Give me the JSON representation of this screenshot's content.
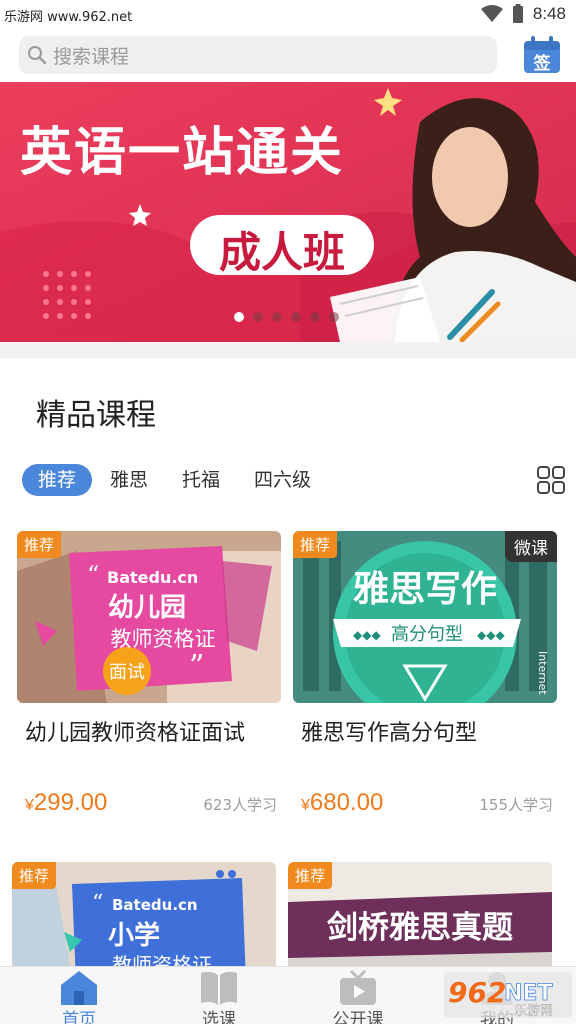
{
  "status_bar": {
    "watermark": "乐游网 www.962.net",
    "time": "8:48"
  },
  "search": {
    "placeholder": "搜索课程",
    "signin_label": "签"
  },
  "banner": {
    "title": "英语一站通关",
    "pill": "成人班",
    "dot_count": 6,
    "active_dot": 0
  },
  "section": {
    "title": "精品课程"
  },
  "tabs": [
    {
      "label": "推荐",
      "active": true
    },
    {
      "label": "雅思",
      "active": false
    },
    {
      "label": "托福",
      "active": false
    },
    {
      "label": "四六级",
      "active": false
    }
  ],
  "courses": [
    {
      "badge": "推荐",
      "thumb_lines": [
        "幼儿园",
        "教师资格证",
        "面试"
      ],
      "brand": "Batedu.cn",
      "title": "幼儿园教师资格证面试",
      "price_symbol": "¥",
      "price": "299.00",
      "learners": "623人学习"
    },
    {
      "badge": "推荐",
      "micro": "微课",
      "thumb_lines": [
        "雅思写作",
        "高分句型",
        "Internet"
      ],
      "title": "雅思写作高分句型",
      "price_symbol": "¥",
      "price": "680.00",
      "learners": "155人学习"
    },
    {
      "badge": "推荐",
      "thumb_lines": [
        "小学",
        "教师资格证"
      ],
      "brand": "Batedu.cn"
    },
    {
      "badge": "推荐",
      "thumb_lines": [
        "剑桥雅思真题"
      ]
    }
  ],
  "bottom_nav": [
    {
      "label": "首页",
      "icon": "home-icon",
      "active": true
    },
    {
      "label": "选课",
      "icon": "book-icon",
      "active": false
    },
    {
      "label": "公开课",
      "icon": "tv-icon",
      "active": false
    },
    {
      "label": "我的",
      "icon": "user-icon",
      "active": false
    }
  ],
  "watermark_bottom": {
    "brand": "962",
    "suffix": "NET",
    "sub": "乐游网"
  },
  "colors": {
    "accent": "#4a86d9",
    "banner": "#e53457",
    "price": "#f07a1a",
    "badge": "#f08a1e"
  }
}
